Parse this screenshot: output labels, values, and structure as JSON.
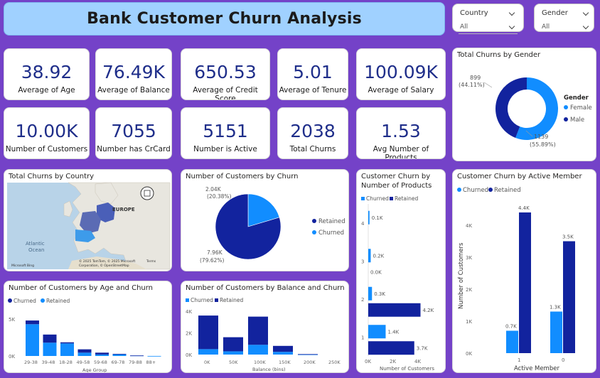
{
  "title": "Bank Customer Churn Analysis",
  "slicers": [
    {
      "label": "Country",
      "value": "All"
    },
    {
      "label": "Gender",
      "value": "All"
    }
  ],
  "kpis": [
    {
      "value": "38.92",
      "label": "Average of Age"
    },
    {
      "value": "76.49K",
      "label": "Average of Balance"
    },
    {
      "value": "650.53",
      "label": "Average of Credit Score"
    },
    {
      "value": "5.01",
      "label": "Average of Tenure"
    },
    {
      "value": "100.09K",
      "label": "Average of Salary"
    },
    {
      "value": "10.00K",
      "label": "Number of Customers"
    },
    {
      "value": "7055",
      "label": "Number has CrCard"
    },
    {
      "value": "5151",
      "label": "Number is Active"
    },
    {
      "value": "2038",
      "label": "Total Churns"
    },
    {
      "value": "1.53",
      "label": "Avg Number of Products"
    }
  ],
  "colors": {
    "churned": "#118dff",
    "retained": "#12239e",
    "kpi_text": "#1f2e8a",
    "background": "#7442c8",
    "title_bg": "#a0d1ff"
  },
  "map": {
    "title": "Total Churns by Country",
    "labels": {
      "europe": "EUROPE",
      "ocean_1": "Atlantic",
      "ocean_2": "Ocean",
      "bing": "Microsoft Bing"
    },
    "attribution": [
      "© 2025 TomTom, © 2025 Microsoft",
      "Corporation, © OpenStreetMap",
      "Terms"
    ]
  },
  "chart_data": [
    {
      "id": "gender",
      "type": "pie",
      "title": "Total Churns by Gender",
      "legend_title": "Gender",
      "legend": [
        "Female",
        "Male"
      ],
      "slices": [
        {
          "name": "Female",
          "value": 1139,
          "label": "1139",
          "pct": "(55.89%)"
        },
        {
          "name": "Male",
          "value": 899,
          "label": "899",
          "pct": "(44.11%)"
        }
      ]
    },
    {
      "id": "churn",
      "type": "pie",
      "title": "Number of Customers by Churn",
      "legend": [
        "Retained",
        "Churned"
      ],
      "slices": [
        {
          "name": "Retained",
          "value": 7960,
          "label": "7.96K",
          "pct": "(79.62%)"
        },
        {
          "name": "Churned",
          "value": 2040,
          "label": "2.04K",
          "pct": "(20.38%)"
        }
      ]
    },
    {
      "id": "products",
      "type": "bar",
      "orientation": "horizontal",
      "title": "Customer Churn by Number of Products",
      "title_lines": [
        "Customer Churn by",
        "Number of Products"
      ],
      "legend": [
        "Churned",
        "Retained"
      ],
      "categories": [
        "4",
        "3",
        "2",
        "1"
      ],
      "series": [
        {
          "name": "Churned",
          "values": [
            100,
            200,
            300,
            1400
          ],
          "labels": [
            "0.1K",
            "0.2K",
            "0.3K",
            "1.4K"
          ]
        },
        {
          "name": "Retained",
          "values": [
            0,
            0,
            4200,
            3700
          ],
          "labels": [
            "",
            "0.0K",
            "4.2K",
            "3.7K"
          ]
        }
      ],
      "xticks": [
        "0K",
        "2K",
        "4K"
      ],
      "xlim": [
        0,
        4000
      ],
      "xlabel": "Number of Customers"
    },
    {
      "id": "active",
      "type": "bar",
      "title": "Customer Churn by Active Member",
      "legend": [
        "Churned",
        "Retained"
      ],
      "categories": [
        "1",
        "0"
      ],
      "series": [
        {
          "name": "Churned",
          "values": [
            700,
            1300
          ],
          "labels": [
            "0.7K",
            "1.3K"
          ]
        },
        {
          "name": "Retained",
          "values": [
            4400,
            3500
          ],
          "labels": [
            "4.4K",
            "3.5K"
          ]
        }
      ],
      "yticks": [
        "0K",
        "1K",
        "2K",
        "3K",
        "4K"
      ],
      "ylim": [
        0,
        4000
      ],
      "xlabel": "Active Member",
      "ylabel": "Number of Customers"
    },
    {
      "id": "age",
      "type": "bar",
      "stacked": true,
      "title": "Number of Customers by Age and Churn",
      "legend": [
        "Churned",
        "Retained"
      ],
      "categories": [
        "29-38",
        "39-48",
        "18-28",
        "49-58",
        "59-68",
        "69-78",
        "79-88",
        "88+"
      ],
      "series": [
        {
          "name": "Churned",
          "values": [
            500,
            1100,
            150,
            450,
            250,
            30,
            5,
            0
          ]
        },
        {
          "name": "Retained",
          "values": [
            4300,
            1800,
            1700,
            450,
            200,
            250,
            60,
            5
          ]
        }
      ],
      "yticks": [
        "0K",
        "5K"
      ],
      "ylim": [
        0,
        5000
      ],
      "xlabel": "Age Group"
    },
    {
      "id": "balance",
      "type": "bar",
      "stacked": true,
      "title": "Number of Customers by Balance and Churn",
      "legend": [
        "Churned",
        "Retained"
      ],
      "categories": [
        "0K",
        "50K",
        "100K",
        "150K",
        "200K",
        "250K"
      ],
      "series": [
        {
          "name": "Churned",
          "values": [
            500,
            300,
            900,
            250,
            10,
            0
          ]
        },
        {
          "name": "Retained",
          "values": [
            3100,
            1300,
            2600,
            550,
            30,
            0
          ]
        }
      ],
      "yticks": [
        "0K",
        "2K",
        "4K"
      ],
      "ylim": [
        0,
        4000
      ],
      "xlabel": "Balance (bins)"
    }
  ]
}
